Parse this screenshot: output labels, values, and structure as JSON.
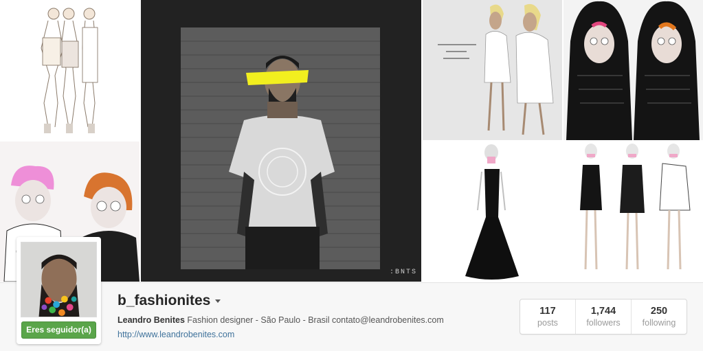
{
  "profile": {
    "username": "b_fashionites",
    "full_name": "Leandro Benites",
    "bio": "Fashion designer - São Paulo - Brasil contato@leandrobenites.com",
    "website": "http://www.leandrobenites.com",
    "follow_button_label": "Eres seguidor(a)"
  },
  "stats": [
    {
      "count": "117",
      "label": "posts"
    },
    {
      "count": "1,744",
      "label": "followers"
    },
    {
      "count": "250",
      "label": "following"
    }
  ],
  "photos": [
    {
      "id": "sketch-three-models-1"
    },
    {
      "id": "man-brick-wall-featured",
      "watermark": ":BNTS"
    },
    {
      "id": "sketch-two-models-white"
    },
    {
      "id": "sketch-hooded-figures"
    },
    {
      "id": "sketch-pink-orange-hair"
    },
    {
      "id": "sketch-black-gown"
    },
    {
      "id": "sketch-three-models-2"
    }
  ],
  "colors": {
    "follow_green": "#5aa54a",
    "link_blue": "#3f729b",
    "highlight_yellow": "#f2ef1f"
  },
  "icons": {
    "username_dropdown": "chevron-down-icon"
  }
}
